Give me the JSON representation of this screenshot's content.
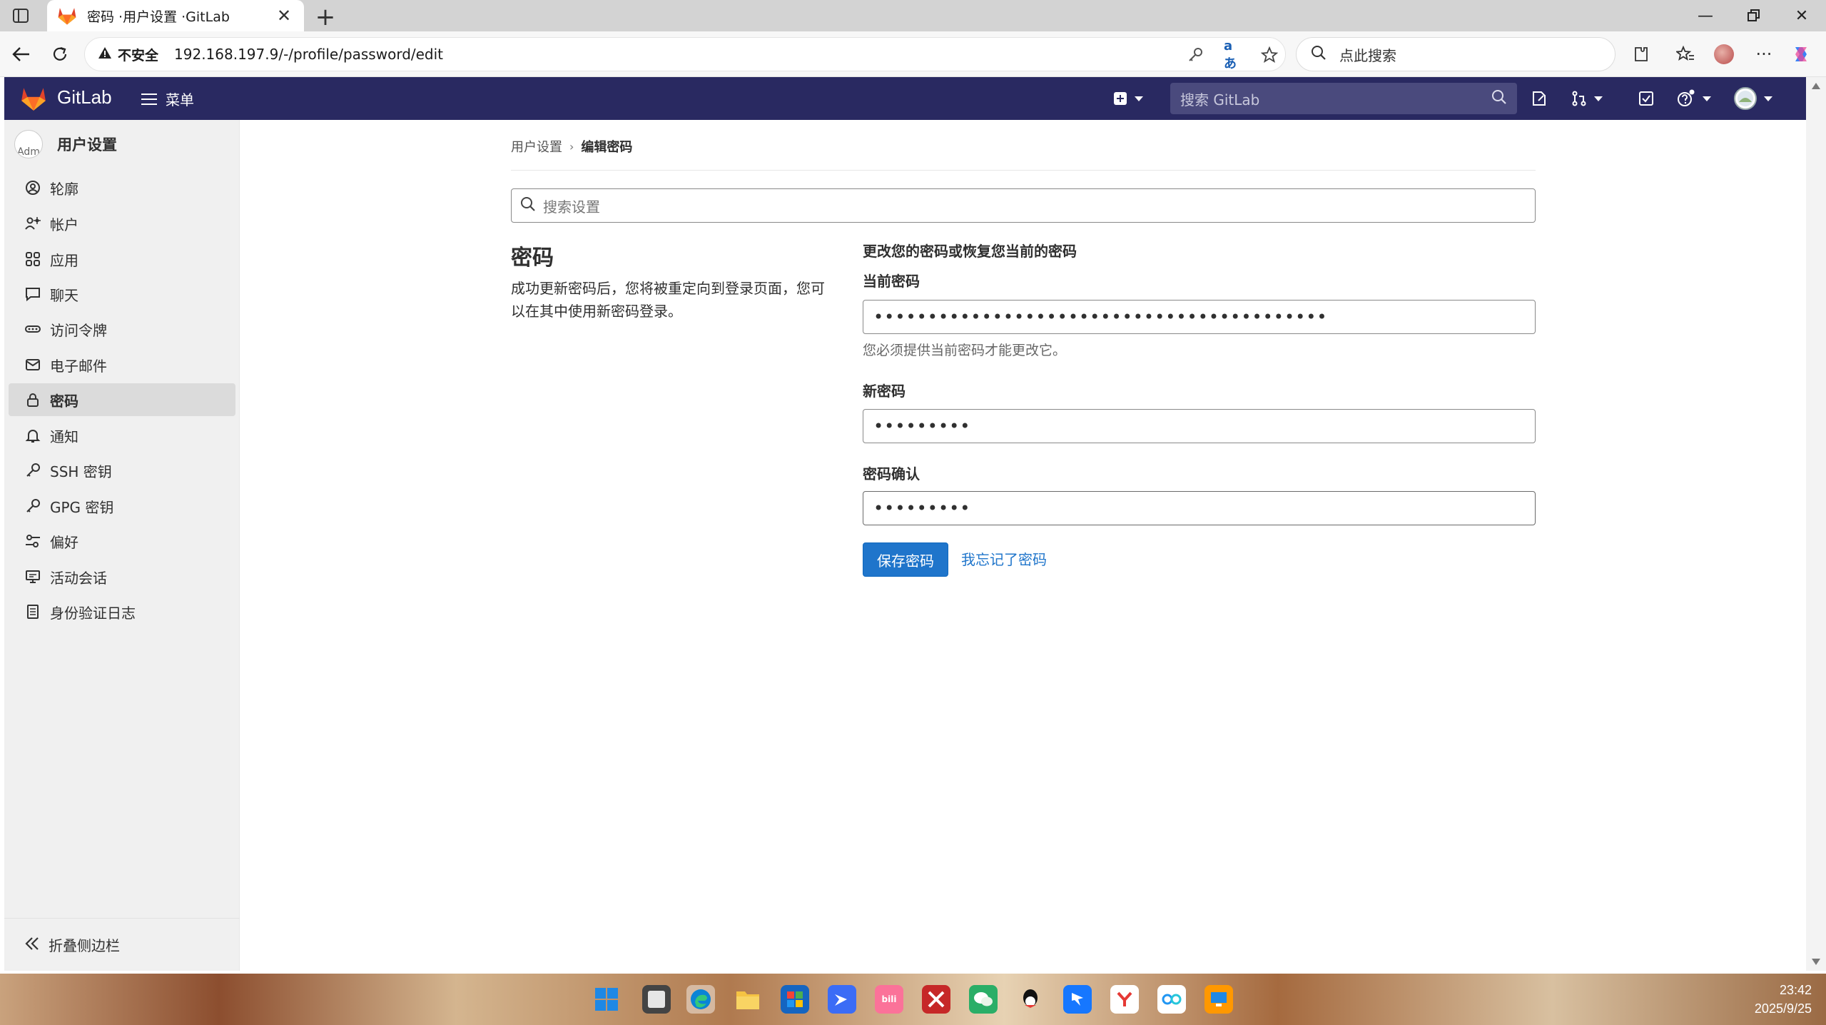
{
  "browser": {
    "tab_title": "密码 ·用户设置 ·GitLab",
    "insecure_label": "不安全",
    "url": "192.168.197.9/-/profile/password/edit",
    "search_placeholder": "点此搜索"
  },
  "gitlab_header": {
    "brand": "GitLab",
    "menu_label": "菜单",
    "search_placeholder": "搜索 GitLab"
  },
  "sidebar": {
    "avatar_text": "Adm",
    "title": "用户设置",
    "items": [
      {
        "label": "轮廓",
        "icon": "profile-icon"
      },
      {
        "label": "帐户",
        "icon": "account-icon"
      },
      {
        "label": "应用",
        "icon": "applications-icon"
      },
      {
        "label": "聊天",
        "icon": "chat-icon"
      },
      {
        "label": "访问令牌",
        "icon": "token-icon"
      },
      {
        "label": "电子邮件",
        "icon": "email-icon"
      },
      {
        "label": "密码",
        "icon": "lock-icon",
        "active": true
      },
      {
        "label": "通知",
        "icon": "bell-icon"
      },
      {
        "label": "SSH 密钥",
        "icon": "key-icon"
      },
      {
        "label": "GPG 密钥",
        "icon": "key-icon"
      },
      {
        "label": "偏好",
        "icon": "preferences-icon"
      },
      {
        "label": "活动会话",
        "icon": "sessions-icon"
      },
      {
        "label": "身份验证日志",
        "icon": "log-icon"
      }
    ],
    "collapse_label": "折叠侧边栏"
  },
  "breadcrumb": {
    "parent": "用户设置",
    "current": "编辑密码"
  },
  "settings_search_placeholder": "搜索设置",
  "section": {
    "title": "密码",
    "description": "成功更新密码后，您将被重定向到登录页面，您可以在其中使用新密码登录。"
  },
  "form": {
    "heading": "更改您的密码或恢复您当前的密码",
    "current_label": "当前密码",
    "current_value": "••••••••••••••••••••••••••••••••••••••••••",
    "current_help": "您必须提供当前密码才能更改它。",
    "new_label": "新密码",
    "new_value": "•••••••••",
    "confirm_label": "密码确认",
    "confirm_value": "•••••••••",
    "save_label": "保存密码",
    "forgot_label": "我忘记了密码"
  },
  "taskbar": {
    "time": "23:42",
    "date": "2025/9/25"
  },
  "colors": {
    "header_bg": "#292961",
    "primary": "#1f75cb",
    "sidebar_bg": "#f0f0f0"
  }
}
